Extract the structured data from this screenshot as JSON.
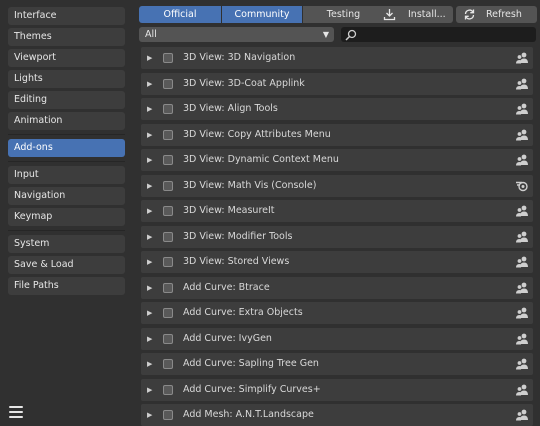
{
  "sidebar": {
    "items": [
      {
        "label": "Interface"
      },
      {
        "label": "Themes"
      },
      {
        "label": "Viewport"
      },
      {
        "label": "Lights"
      },
      {
        "label": "Editing"
      },
      {
        "label": "Animation"
      },
      {
        "label": "Add-ons",
        "active": true
      },
      {
        "label": "Input"
      },
      {
        "label": "Navigation"
      },
      {
        "label": "Keymap"
      },
      {
        "label": "System"
      },
      {
        "label": "Save & Load"
      },
      {
        "label": "File Paths"
      }
    ],
    "menu_icon": "hamburger-menu-icon"
  },
  "toolbar": {
    "tabs": [
      {
        "label": "Official",
        "selected": true
      },
      {
        "label": "Community",
        "selected": true
      },
      {
        "label": "Testing",
        "selected": false
      }
    ],
    "install_label": "Install...",
    "refresh_label": "Refresh"
  },
  "filter": {
    "value": "All"
  },
  "search": {
    "placeholder": ""
  },
  "addons": [
    {
      "name": "3D View: 3D Navigation",
      "icon": "community"
    },
    {
      "name": "3D View: 3D-Coat Applink",
      "icon": "community"
    },
    {
      "name": "3D View: Align Tools",
      "icon": "community"
    },
    {
      "name": "3D View: Copy Attributes Menu",
      "icon": "community"
    },
    {
      "name": "3D View: Dynamic Context Menu",
      "icon": "community"
    },
    {
      "name": "3D View: Math Vis (Console)",
      "icon": "official"
    },
    {
      "name": "3D View: MeasureIt",
      "icon": "community"
    },
    {
      "name": "3D View: Modifier Tools",
      "icon": "community"
    },
    {
      "name": "3D View: Stored Views",
      "icon": "community"
    },
    {
      "name": "Add Curve: Btrace",
      "icon": "community"
    },
    {
      "name": "Add Curve: Extra Objects",
      "icon": "community"
    },
    {
      "name": "Add Curve: IvyGen",
      "icon": "community"
    },
    {
      "name": "Add Curve: Sapling Tree Gen",
      "icon": "community"
    },
    {
      "name": "Add Curve: Simplify Curves+",
      "icon": "community"
    },
    {
      "name": "Add Mesh: A.N.T.Landscape",
      "icon": "community"
    }
  ],
  "colors": {
    "accent": "#4772b3",
    "panel": "#303030",
    "row": "#3d3d3d",
    "button": "#545454"
  }
}
